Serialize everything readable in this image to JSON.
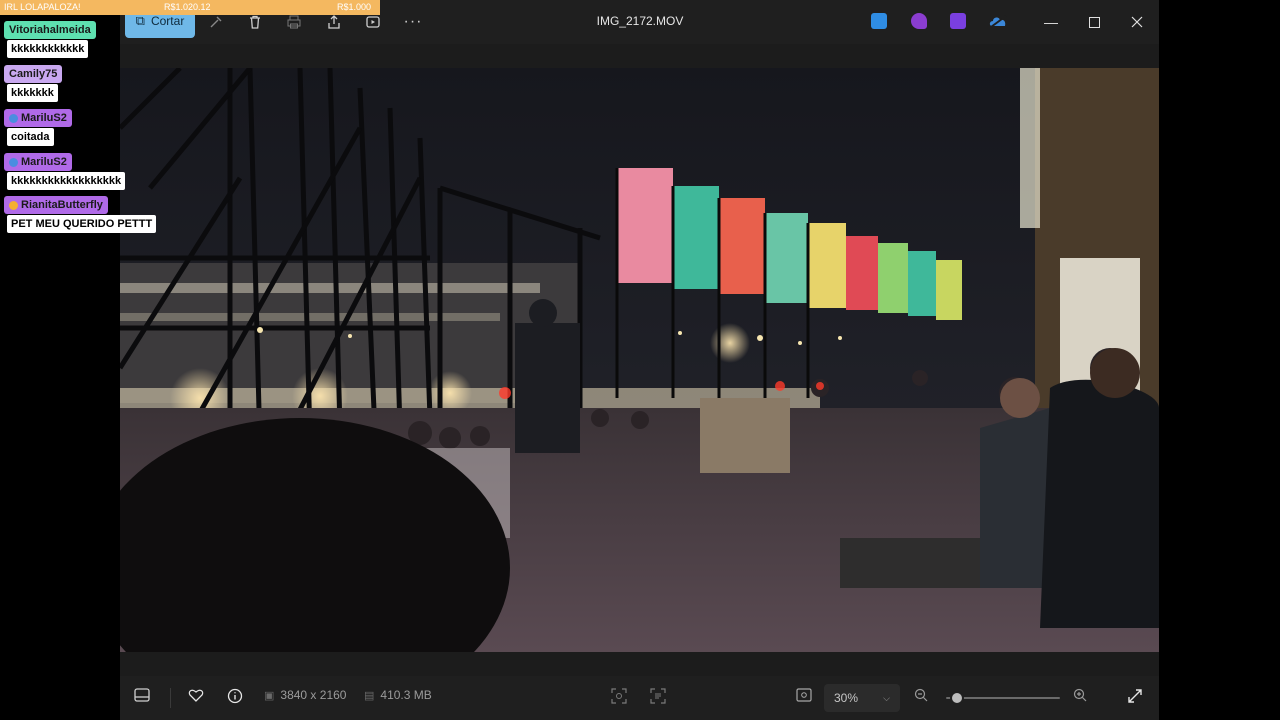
{
  "overlay": {
    "goal_left": "IRL LOLAPALOZA!",
    "goal_mid": "R$1.020.12",
    "goal_right": "R$1.000",
    "chat": [
      {
        "user": "Vitoriahalmeida",
        "msg": "kkkkkkkkkkkk",
        "color": "#5ee0b0"
      },
      {
        "user": "Camily75",
        "msg": "kkkkkkk",
        "color": "#c9a8f0"
      },
      {
        "user": "MariluS2",
        "msg": "coitada",
        "color": "#b06ae8"
      },
      {
        "user": "MariluS2",
        "msg": "kkkkkkkkkkkkkkkkkk",
        "color": "#b06ae8"
      },
      {
        "user": "RianitaButterfly",
        "msg": "PET MEU QUERIDO PETTT",
        "color": "#b06ae8"
      }
    ]
  },
  "toolbar": {
    "crop_label": "Cortar",
    "file_title": "IMG_2172.MOV",
    "icons": [
      "crop-icon",
      "adjust-icon",
      "delete-icon",
      "print-icon",
      "share-icon",
      "video-icon",
      "more-icon"
    ],
    "app_colors": [
      "#2f8de4",
      "#8b3dd0",
      "#7a3fe0",
      "#3b87d8"
    ]
  },
  "bottombar": {
    "dimensions": "3840 x 2160",
    "file_size": "410.3 MB",
    "zoom": "30%",
    "zoom_fraction": 0.1
  }
}
